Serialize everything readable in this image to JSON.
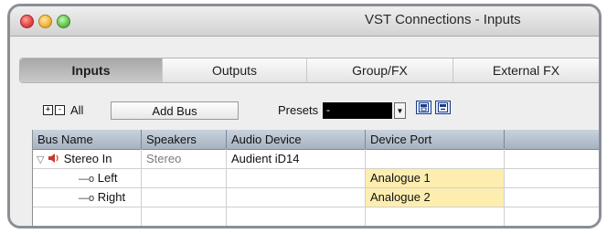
{
  "window": {
    "title": "VST Connections - Inputs"
  },
  "tabs": [
    {
      "label": "Inputs",
      "active": true
    },
    {
      "label": "Outputs",
      "active": false
    },
    {
      "label": "Group/FX",
      "active": false
    },
    {
      "label": "External FX",
      "active": false
    }
  ],
  "toolbar": {
    "expand_icon": "expand-all-icon",
    "collapse_icon": "collapse-all-icon",
    "all_label": "All",
    "add_bus_label": "Add Bus",
    "presets_label": "Presets",
    "preset_value": "-",
    "store_preset_icon": "store-preset-icon",
    "remove_preset_icon": "remove-preset-icon"
  },
  "table": {
    "columns": [
      "Bus Name",
      "Speakers",
      "Audio Device",
      "Device Port"
    ],
    "rows": [
      {
        "bus_name": "Stereo In",
        "speakers": "Stereo",
        "audio_device": "Audient iD14",
        "device_port": ""
      },
      {
        "bus_name": "Left",
        "speakers": "",
        "audio_device": "",
        "device_port": "Analogue 1"
      },
      {
        "bus_name": "Right",
        "speakers": "",
        "audio_device": "",
        "device_port": "Analogue 2"
      }
    ]
  },
  "colors": {
    "port_highlight": "#fdeeb0",
    "header_bg": "#b6c1ce"
  }
}
